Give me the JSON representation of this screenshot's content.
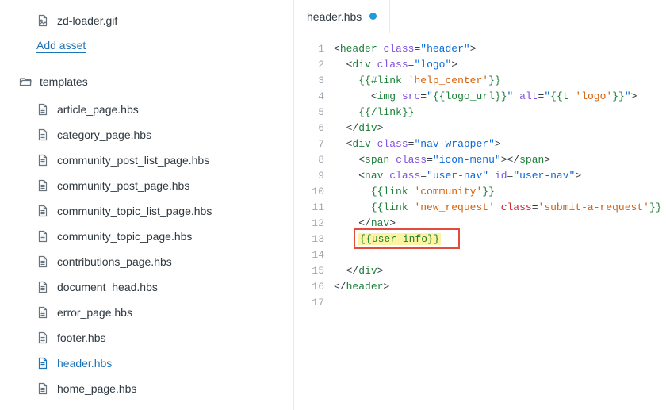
{
  "sidebar": {
    "assets": [
      {
        "name": "zd-loader.gif",
        "icon": "image-icon"
      }
    ],
    "add_asset": "Add asset",
    "folder_label": "templates",
    "templates": [
      {
        "name": "article_page.hbs",
        "active": false
      },
      {
        "name": "category_page.hbs",
        "active": false
      },
      {
        "name": "community_post_list_page.hbs",
        "active": false
      },
      {
        "name": "community_post_page.hbs",
        "active": false
      },
      {
        "name": "community_topic_list_page.hbs",
        "active": false
      },
      {
        "name": "community_topic_page.hbs",
        "active": false
      },
      {
        "name": "contributions_page.hbs",
        "active": false
      },
      {
        "name": "document_head.hbs",
        "active": false
      },
      {
        "name": "error_page.hbs",
        "active": false
      },
      {
        "name": "footer.hbs",
        "active": false
      },
      {
        "name": "header.hbs",
        "active": true
      },
      {
        "name": "home_page.hbs",
        "active": false
      }
    ]
  },
  "editor": {
    "tab": {
      "label": "header.hbs",
      "dirty": true
    },
    "line_count": 17,
    "highlight_box": {
      "top_line": 13,
      "left_ch": 4,
      "width_ch": 16
    },
    "code_lines": [
      {
        "n": 1,
        "tokens": [
          {
            "t": "<",
            "c": "plain"
          },
          {
            "t": "header",
            "c": "green"
          },
          {
            "t": " ",
            "c": "plain"
          },
          {
            "t": "class",
            "c": "purple"
          },
          {
            "t": "=",
            "c": "plain"
          },
          {
            "t": "\"header\"",
            "c": "blue"
          },
          {
            "t": ">",
            "c": "plain"
          }
        ]
      },
      {
        "n": 2,
        "indent": 2,
        "tokens": [
          {
            "t": "<",
            "c": "plain"
          },
          {
            "t": "div",
            "c": "green"
          },
          {
            "t": " ",
            "c": "plain"
          },
          {
            "t": "class",
            "c": "purple"
          },
          {
            "t": "=",
            "c": "plain"
          },
          {
            "t": "\"logo\"",
            "c": "blue"
          },
          {
            "t": ">",
            "c": "plain"
          }
        ]
      },
      {
        "n": 3,
        "indent": 4,
        "tokens": [
          {
            "t": "{{",
            "c": "brace"
          },
          {
            "t": "#link",
            "c": "green"
          },
          {
            "t": " ",
            "c": "plain"
          },
          {
            "t": "'help_center'",
            "c": "orange"
          },
          {
            "t": "}}",
            "c": "brace"
          }
        ]
      },
      {
        "n": 4,
        "indent": 6,
        "tokens": [
          {
            "t": "<",
            "c": "plain"
          },
          {
            "t": "img",
            "c": "green"
          },
          {
            "t": " ",
            "c": "plain"
          },
          {
            "t": "src",
            "c": "purple"
          },
          {
            "t": "=",
            "c": "plain"
          },
          {
            "t": "\"",
            "c": "blue"
          },
          {
            "t": "{{",
            "c": "brace"
          },
          {
            "t": "logo_url",
            "c": "green"
          },
          {
            "t": "}}",
            "c": "brace"
          },
          {
            "t": "\"",
            "c": "blue"
          },
          {
            "t": " ",
            "c": "plain"
          },
          {
            "t": "alt",
            "c": "purple"
          },
          {
            "t": "=",
            "c": "plain"
          },
          {
            "t": "\"",
            "c": "blue"
          },
          {
            "t": "{{",
            "c": "brace"
          },
          {
            "t": "t",
            "c": "green"
          },
          {
            "t": " ",
            "c": "plain"
          },
          {
            "t": "'logo'",
            "c": "orange"
          },
          {
            "t": "}}",
            "c": "brace"
          },
          {
            "t": "\"",
            "c": "blue"
          },
          {
            "t": ">",
            "c": "plain"
          }
        ]
      },
      {
        "n": 5,
        "indent": 4,
        "tokens": [
          {
            "t": "{{",
            "c": "brace"
          },
          {
            "t": "/link",
            "c": "green"
          },
          {
            "t": "}}",
            "c": "brace"
          }
        ]
      },
      {
        "n": 6,
        "indent": 2,
        "tokens": [
          {
            "t": "</",
            "c": "plain"
          },
          {
            "t": "div",
            "c": "green"
          },
          {
            "t": ">",
            "c": "plain"
          }
        ]
      },
      {
        "n": 7,
        "indent": 2,
        "tokens": [
          {
            "t": "<",
            "c": "plain"
          },
          {
            "t": "div",
            "c": "green"
          },
          {
            "t": " ",
            "c": "plain"
          },
          {
            "t": "class",
            "c": "purple"
          },
          {
            "t": "=",
            "c": "plain"
          },
          {
            "t": "\"nav-wrapper\"",
            "c": "blue"
          },
          {
            "t": ">",
            "c": "plain"
          }
        ]
      },
      {
        "n": 8,
        "indent": 4,
        "tokens": [
          {
            "t": "<",
            "c": "plain"
          },
          {
            "t": "span",
            "c": "green"
          },
          {
            "t": " ",
            "c": "plain"
          },
          {
            "t": "class",
            "c": "purple"
          },
          {
            "t": "=",
            "c": "plain"
          },
          {
            "t": "\"icon-menu\"",
            "c": "blue"
          },
          {
            "t": "></",
            "c": "plain"
          },
          {
            "t": "span",
            "c": "green"
          },
          {
            "t": ">",
            "c": "plain"
          }
        ]
      },
      {
        "n": 9,
        "indent": 4,
        "tokens": [
          {
            "t": "<",
            "c": "plain"
          },
          {
            "t": "nav",
            "c": "green"
          },
          {
            "t": " ",
            "c": "plain"
          },
          {
            "t": "class",
            "c": "purple"
          },
          {
            "t": "=",
            "c": "plain"
          },
          {
            "t": "\"user-nav\"",
            "c": "blue"
          },
          {
            "t": " ",
            "c": "plain"
          },
          {
            "t": "id",
            "c": "purple"
          },
          {
            "t": "=",
            "c": "plain"
          },
          {
            "t": "\"user-nav\"",
            "c": "blue"
          },
          {
            "t": ">",
            "c": "plain"
          }
        ]
      },
      {
        "n": 10,
        "indent": 6,
        "tokens": [
          {
            "t": "{{",
            "c": "brace"
          },
          {
            "t": "link",
            "c": "green"
          },
          {
            "t": " ",
            "c": "plain"
          },
          {
            "t": "'community'",
            "c": "orange"
          },
          {
            "t": "}}",
            "c": "brace"
          }
        ]
      },
      {
        "n": 11,
        "indent": 6,
        "tokens": [
          {
            "t": "{{",
            "c": "brace"
          },
          {
            "t": "link",
            "c": "green"
          },
          {
            "t": " ",
            "c": "plain"
          },
          {
            "t": "'new_request'",
            "c": "orange"
          },
          {
            "t": " ",
            "c": "plain"
          },
          {
            "t": "class",
            "c": "red"
          },
          {
            "t": "=",
            "c": "plain"
          },
          {
            "t": "'submit-a-request'",
            "c": "orange"
          },
          {
            "t": "}}",
            "c": "brace"
          }
        ]
      },
      {
        "n": 12,
        "indent": 4,
        "tokens": [
          {
            "t": "</",
            "c": "plain"
          },
          {
            "t": "nav",
            "c": "green"
          },
          {
            "t": ">",
            "c": "plain"
          }
        ]
      },
      {
        "n": 13,
        "indent": 4,
        "hl": true,
        "tokens": [
          {
            "t": "{{",
            "c": "brace"
          },
          {
            "t": "user_info",
            "c": "green"
          },
          {
            "t": "}}",
            "c": "brace"
          }
        ]
      },
      {
        "n": 14,
        "indent": 0,
        "tokens": []
      },
      {
        "n": 15,
        "indent": 2,
        "tokens": [
          {
            "t": "</",
            "c": "plain"
          },
          {
            "t": "div",
            "c": "green"
          },
          {
            "t": ">",
            "c": "plain"
          }
        ]
      },
      {
        "n": 16,
        "indent": 0,
        "tokens": [
          {
            "t": "</",
            "c": "plain"
          },
          {
            "t": "header",
            "c": "green"
          },
          {
            "t": ">",
            "c": "plain"
          }
        ]
      },
      {
        "n": 17,
        "indent": 0,
        "tokens": []
      }
    ]
  }
}
